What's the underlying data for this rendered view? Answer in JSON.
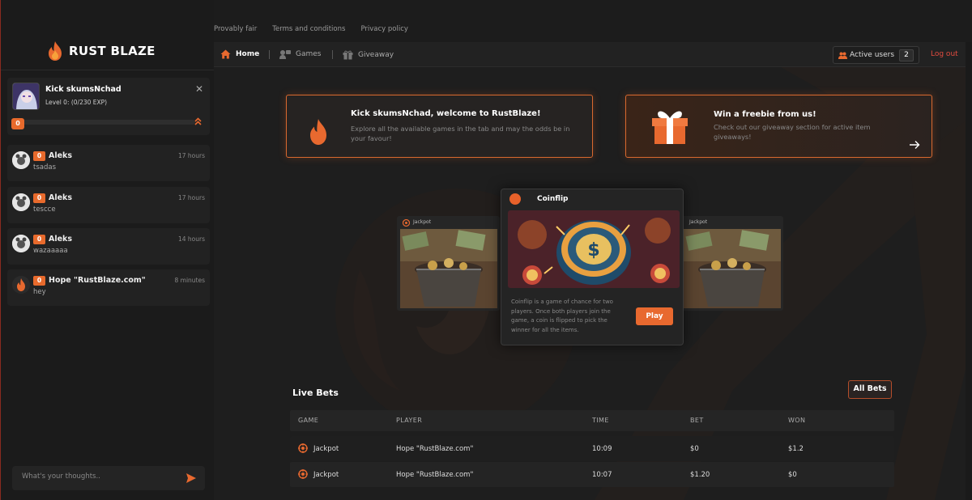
{
  "brand": {
    "name": "RUST BLAZE"
  },
  "top_links": [
    "Provably fair",
    "Terms and conditions",
    "Privacy policy"
  ],
  "nav": {
    "home": "Home",
    "games": "Games",
    "giveaway": "Giveaway",
    "active_users_label": "Active users",
    "active_users_count": "2",
    "logout": "Log out"
  },
  "user": {
    "name": "Kick skumsNchad",
    "level_text": "Level 0:  (0/230 EXP)",
    "level_badge": "0",
    "xp_progress": 0
  },
  "chat": {
    "messages": [
      {
        "name": "Aleks",
        "level": "0",
        "time": "17 hours",
        "text": "tsadas"
      },
      {
        "name": "Aleks",
        "level": "0",
        "time": "17 hours",
        "text": "tescce"
      },
      {
        "name": "Aleks",
        "level": "0",
        "time": "14 hours",
        "text": "wazaaaaa"
      },
      {
        "name": "Hope \"RustBlaze.com\"",
        "level": "0",
        "time": "8 minutes",
        "text": "hey"
      }
    ],
    "input_placeholder": "What's your thoughts.."
  },
  "banners": {
    "welcome": {
      "title": "Kick skumsNchad, welcome to RustBlaze!",
      "desc": "Explore all the available games in the tab and may the odds be in your favour!"
    },
    "freebie": {
      "title": "Win a freebie from us!",
      "desc": "Check out our giveaway section for active item giveaways!"
    }
  },
  "games": {
    "left_card_title": "Jackpot",
    "right_card_title": "Jackpot",
    "featured": {
      "title": "Coinflip",
      "desc": "Coinflip is a game of chance for two players. Once both players join the game, a coin is flipped to pick the winner for all the items.",
      "play_label": "Play"
    }
  },
  "live_bets": {
    "title": "Live Bets",
    "all_bets_label": "All Bets",
    "columns": [
      "GAME",
      "PLAYER",
      "TIME",
      "BET",
      "WON"
    ],
    "rows": [
      {
        "game": "Jackpot",
        "player": "Hope \"RustBlaze.com\"",
        "time": "10:09",
        "bet": "$0",
        "won": "$1.2"
      },
      {
        "game": "Jackpot",
        "player": "Hope \"RustBlaze.com\"",
        "time": "10:07",
        "bet": "$1.20",
        "won": "$0"
      }
    ]
  },
  "colors": {
    "accent": "#e8692f",
    "logout": "#e34b3f",
    "background": "#1c1c1c"
  }
}
